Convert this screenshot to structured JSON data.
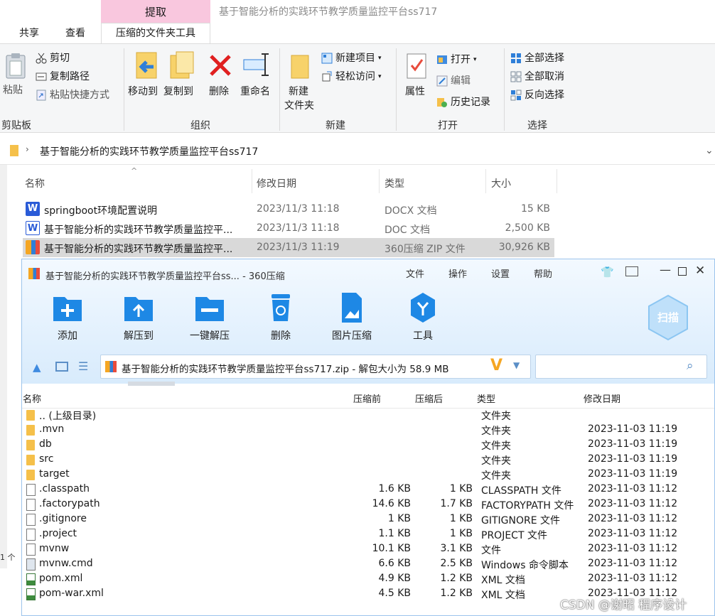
{
  "explorer": {
    "context_tab": "提取",
    "window_title": "基于智能分析的实践环节教学质量监控平台ss717",
    "tabs": [
      "共享",
      "查看",
      "压缩的文件夹工具"
    ],
    "ribbon": {
      "clipboard": {
        "paste": "粘贴",
        "cut": "剪切",
        "copy_path": "复制路径",
        "paste_shortcut": "粘贴快捷方式",
        "label": "剪贴板"
      },
      "organize": {
        "move_to": "移动到",
        "copy_to": "复制到",
        "delete": "删除",
        "rename": "重命名",
        "label": "组织"
      },
      "new": {
        "new_folder_1": "新建",
        "new_folder_2": "文件夹",
        "new_item": "新建项目",
        "easy_access": "轻松访问",
        "label": "新建"
      },
      "open": {
        "properties": "属性",
        "open": "打开",
        "edit": "编辑",
        "history": "历史记录",
        "label": "打开"
      },
      "select": {
        "select_all": "全部选择",
        "select_none": "全部取消",
        "invert": "反向选择",
        "label": "选择"
      }
    },
    "address": "基于智能分析的实践环节教学质量监控平台ss717",
    "columns": {
      "name": "名称",
      "date": "修改日期",
      "type": "类型",
      "size": "大小"
    },
    "files": [
      {
        "name": "springboot环境配置说明",
        "date": "2023/11/3 11:18",
        "type": "DOCX 文档",
        "size": "15 KB"
      },
      {
        "name": "基于智能分析的实践环节教学质量监控平...",
        "date": "2023/11/3 11:18",
        "type": "DOC 文档",
        "size": "2,500 KB"
      },
      {
        "name": "基于智能分析的实践环节教学质量监控平...",
        "date": "2023/11/3 11:19",
        "type": "360压缩 ZIP 文件",
        "size": "30,926 KB"
      }
    ],
    "side_fragment": "1 个"
  },
  "zip": {
    "title": "基于智能分析的实践环节教学质量监控平台ss... - 360压缩",
    "menu": [
      "文件",
      "操作",
      "设置",
      "帮助"
    ],
    "tools": [
      "添加",
      "解压到",
      "一键解压",
      "删除",
      "图片压缩",
      "工具"
    ],
    "scan": "扫描",
    "path": "基于智能分析的实践环节教学质量监控平台ss717.zip - 解包大小为 58.9 MB",
    "columns": {
      "name": "名称",
      "before": "压缩前",
      "after": "压缩后",
      "type": "类型",
      "date": "修改日期"
    },
    "entries": [
      {
        "name": ".. (上级目录)",
        "before": "",
        "after": "",
        "type": "文件夹",
        "date": "",
        "kind": "folder"
      },
      {
        "name": ".mvn",
        "before": "",
        "after": "",
        "type": "文件夹",
        "date": "2023-11-03 11:19",
        "kind": "folder"
      },
      {
        "name": "db",
        "before": "",
        "after": "",
        "type": "文件夹",
        "date": "2023-11-03 11:19",
        "kind": "folder"
      },
      {
        "name": "src",
        "before": "",
        "after": "",
        "type": "文件夹",
        "date": "2023-11-03 11:19",
        "kind": "folder"
      },
      {
        "name": "target",
        "before": "",
        "after": "",
        "type": "文件夹",
        "date": "2023-11-03 11:19",
        "kind": "folder"
      },
      {
        "name": ".classpath",
        "before": "1.6 KB",
        "after": "1 KB",
        "type": "CLASSPATH 文件",
        "date": "2023-11-03 11:12",
        "kind": "file"
      },
      {
        "name": ".factorypath",
        "before": "14.6 KB",
        "after": "1.7 KB",
        "type": "FACTORYPATH 文件",
        "date": "2023-11-03 11:12",
        "kind": "file"
      },
      {
        "name": ".gitignore",
        "before": "1 KB",
        "after": "1 KB",
        "type": "GITIGNORE 文件",
        "date": "2023-11-03 11:12",
        "kind": "file"
      },
      {
        "name": ".project",
        "before": "1.1 KB",
        "after": "1 KB",
        "type": "PROJECT 文件",
        "date": "2023-11-03 11:12",
        "kind": "file"
      },
      {
        "name": "mvnw",
        "before": "10.1 KB",
        "after": "3.1 KB",
        "type": "文件",
        "date": "2023-11-03 11:12",
        "kind": "file"
      },
      {
        "name": "mvnw.cmd",
        "before": "6.6 KB",
        "after": "2.5 KB",
        "type": "Windows 命令脚本",
        "date": "2023-11-03 11:12",
        "kind": "cmd"
      },
      {
        "name": "pom.xml",
        "before": "4.9 KB",
        "after": "1.2 KB",
        "type": "XML 文档",
        "date": "2023-11-03 11:12",
        "kind": "xml"
      },
      {
        "name": "pom-war.xml",
        "before": "4.5 KB",
        "after": "1.2 KB",
        "type": "XML 文档",
        "date": "2023-11-03 11:12",
        "kind": "xml"
      }
    ]
  },
  "watermark": "CSDN @谢昭  程序设计",
  "colors": {
    "context_tab": "#f9c7de",
    "zip_header": "#d8ebfc",
    "accent_blue": "#1e88e5",
    "folder": "#f5c04a",
    "selected_row": "#d9d9d9"
  },
  "icons": [
    "paste-icon",
    "scissors-icon",
    "copy-path-icon",
    "shortcut-icon",
    "move-to-icon",
    "copy-to-icon",
    "delete-x-icon",
    "rename-icon",
    "new-folder-icon",
    "properties-icon",
    "open-icon",
    "edit-icon",
    "history-icon",
    "select-all-icon",
    "select-none-icon",
    "invert-select-icon"
  ]
}
